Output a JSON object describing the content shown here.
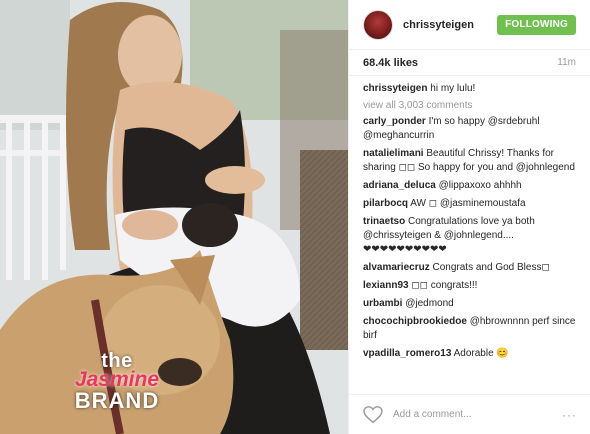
{
  "post": {
    "username": "chrissyteigen",
    "follow_label": "FOLLOWING",
    "likes": "68.4k likes",
    "time": "11m",
    "caption_user": "chrissyteigen",
    "caption_text": "hi my lulu!",
    "view_all": "view all 3,003 comments",
    "add_comment_placeholder": "Add a comment...",
    "more": "···"
  },
  "comments": [
    {
      "user": "carly_ponder",
      "text": "I'm so happy @srdebruhl @meghancurrin"
    },
    {
      "user": "natalielimani",
      "text": "Beautiful Chrissy! Thanks for sharing ◻◻ So happy for you and @johnlegend"
    },
    {
      "user": "adriana_deluca",
      "text": "@lippaxoxo ahhhh"
    },
    {
      "user": "pilarbocq",
      "text": "AW ◻ @jasminemoustafa"
    },
    {
      "user": "trinaetso",
      "text": "Congratulations love ya both @chrissyteigen & @johnlegend...."
    },
    {
      "user": "",
      "text": "❤❤❤❤❤❤❤❤❤❤"
    },
    {
      "user": "alvamariecruz",
      "text": "Congrats and God Bless◻"
    },
    {
      "user": "lexiann93",
      "text": "◻◻ congrats!!!"
    },
    {
      "user": "urbambi",
      "text": "@jedmond"
    },
    {
      "user": "chocochipbrookiedoe",
      "text": "@hbrownnnn perf since birf"
    },
    {
      "user": "vpadilla_romero13",
      "text": "Adorable 😊"
    }
  ],
  "watermark": {
    "line1": "the",
    "line2": "Jasmine",
    "line3": "BRAND"
  },
  "colors": {
    "follow": "#70c050",
    "watermark_pink": "#e8365f"
  }
}
